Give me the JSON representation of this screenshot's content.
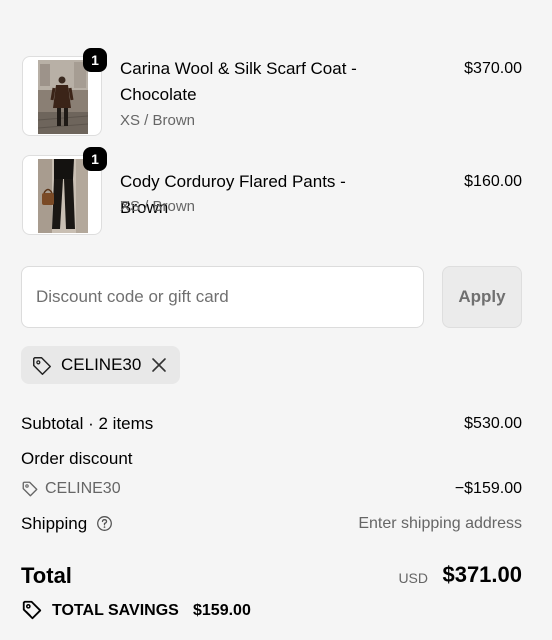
{
  "line_items": [
    {
      "title": "Carina Wool & Silk Scarf Coat - Chocolate",
      "variant": "XS / Brown",
      "price": "$370.00",
      "quantity": "1",
      "image": "product-photo-coat"
    },
    {
      "title": "Cody Corduroy Flared Pants - Brown",
      "variant": "XS / Brown",
      "price": "$160.00",
      "quantity": "1",
      "image": "product-photo-pants"
    }
  ],
  "discount_form": {
    "placeholder": "Discount code or gift card",
    "value": "",
    "apply_label": "Apply"
  },
  "applied_code": {
    "label": "CELINE30",
    "icon": "tag-icon",
    "remove_icon": "close-icon"
  },
  "totals": {
    "subtotal_label": "Subtotal · 2 items",
    "subtotal_value": "$530.00",
    "discount_heading": "Order discount",
    "discount_code": "CELINE30",
    "discount_value": "−$159.00",
    "shipping_label": "Shipping",
    "shipping_help_icon": "help-circle-icon",
    "shipping_value": "Enter shipping address",
    "total_label": "Total",
    "currency": "USD",
    "total_value": "$371.00",
    "savings_label": "TOTAL SAVINGS",
    "savings_value": "$159.00"
  },
  "colors": {
    "background": "#f5f5f5",
    "text": "#000000",
    "muted_text": "#666666",
    "badge": "#000000",
    "apply_button": "#ebebeb",
    "code_tag": "#e8e8e8"
  }
}
